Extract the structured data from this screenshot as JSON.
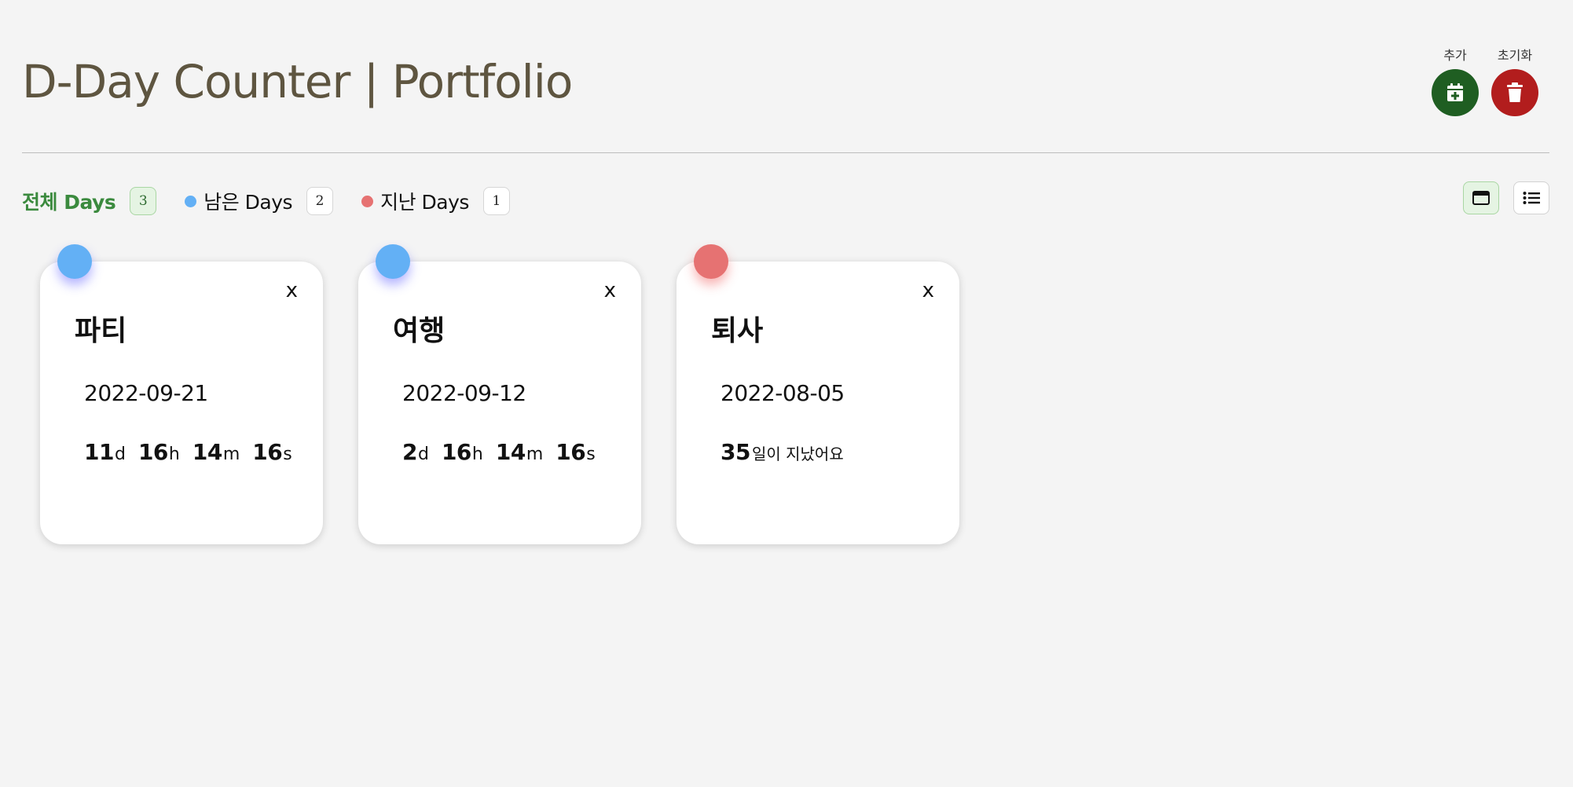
{
  "header": {
    "title": "D-Day Counter | Portfolio",
    "add_label": "추가",
    "reset_label": "초기화"
  },
  "colors": {
    "add_button": "#1f5e22",
    "reset_button": "#b21d1d",
    "remaining": "#63b0f5",
    "passed": "#e67272",
    "active_filter": "#3b8a3e",
    "title": "#5e5540"
  },
  "filters": {
    "all": {
      "label": "전체 Days",
      "count": "3"
    },
    "remaining": {
      "label": "남은 Days",
      "count": "2"
    },
    "passed": {
      "label": "지난 Days",
      "count": "1"
    }
  },
  "view": {
    "card_icon": "window-icon",
    "list_icon": "list-icon",
    "selected": "card"
  },
  "cards": [
    {
      "status": "remaining",
      "title": "파티",
      "date": "2022-09-21",
      "close": "x",
      "days": "11",
      "hours": "16",
      "minutes": "14",
      "seconds": "16",
      "d_unit": "d",
      "h_unit": "h",
      "m_unit": "m",
      "s_unit": "s"
    },
    {
      "status": "remaining",
      "title": "여행",
      "date": "2022-09-12",
      "close": "x",
      "days": "2",
      "hours": "16",
      "minutes": "14",
      "seconds": "16",
      "d_unit": "d",
      "h_unit": "h",
      "m_unit": "m",
      "s_unit": "s"
    },
    {
      "status": "passed",
      "title": "퇴사",
      "date": "2022-08-05",
      "close": "x",
      "days_passed": "35",
      "passed_text": "일이 지났어요"
    }
  ]
}
